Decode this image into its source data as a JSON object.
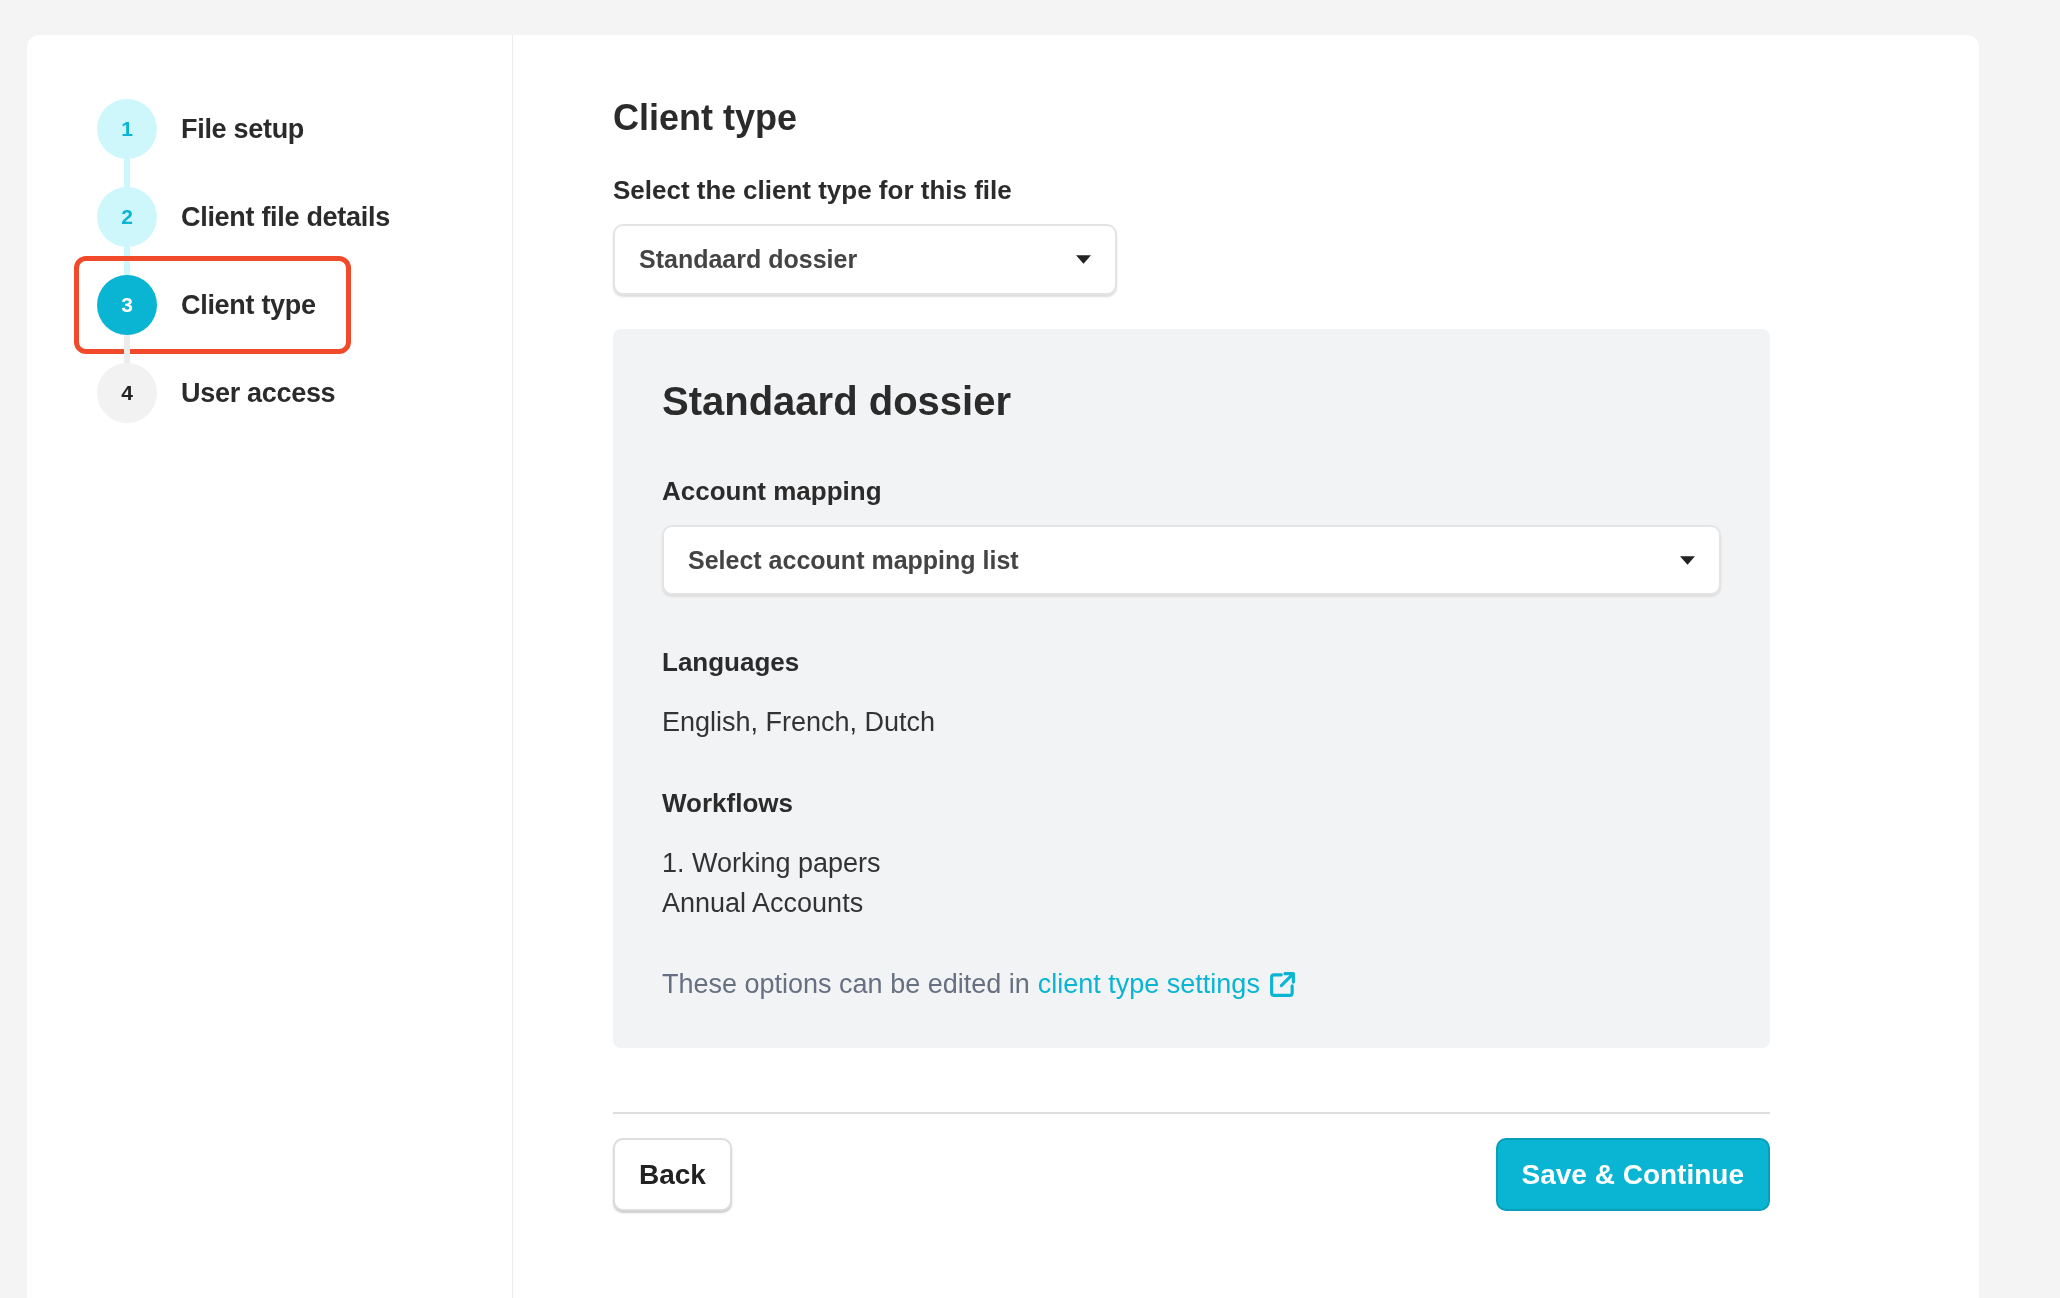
{
  "steps": [
    {
      "number": "1",
      "label": "File setup",
      "done": true,
      "selected": false,
      "highlighted": false
    },
    {
      "number": "2",
      "label": "Client file details",
      "done": true,
      "selected": false,
      "highlighted": false
    },
    {
      "number": "3",
      "label": "Client type",
      "done": false,
      "selected": true,
      "highlighted": true
    },
    {
      "number": "4",
      "label": "User access",
      "done": false,
      "selected": false,
      "highlighted": false
    }
  ],
  "title": "Client type",
  "client_type_field": {
    "label": "Select the client type for this file",
    "value": "Standaard dossier"
  },
  "panel": {
    "title": "Standaard dossier",
    "account_mapping": {
      "label": "Account mapping",
      "value": "Select account mapping list"
    },
    "languages": {
      "label": "Languages",
      "value": "English, French, Dutch"
    },
    "workflows": {
      "label": "Workflows",
      "items": [
        "1. Working papers",
        "Annual Accounts"
      ]
    },
    "note": {
      "text": "These options can be edited in",
      "link": "client type settings"
    }
  },
  "buttons": {
    "back": "Back",
    "save": "Save & Continue"
  }
}
